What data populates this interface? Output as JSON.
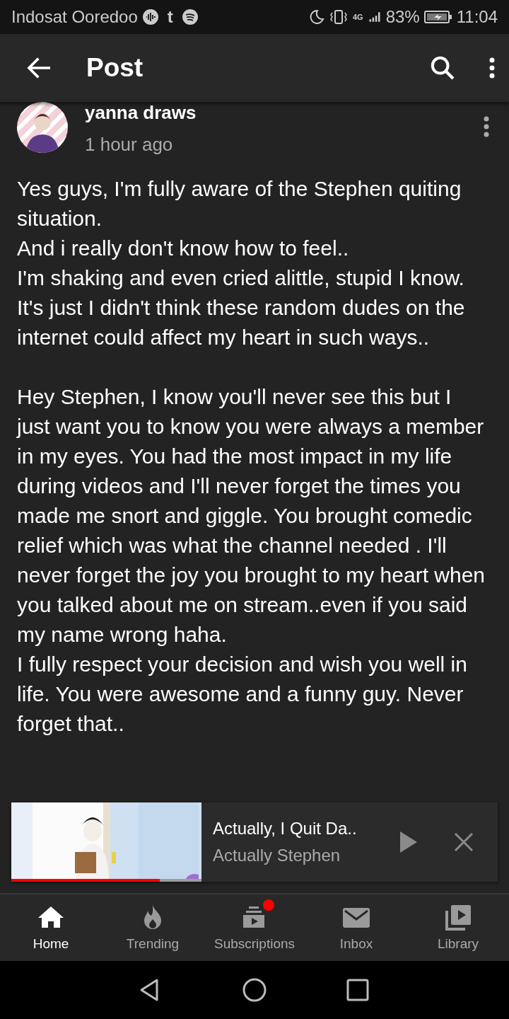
{
  "status_bar": {
    "carrier": "Indosat Ooredoo",
    "app_glyph": "t",
    "network": "4G",
    "battery": "83%",
    "time": "11:04"
  },
  "app_bar": {
    "title": "Post"
  },
  "post": {
    "author": "yanna draws",
    "time": "1 hour ago",
    "blocks": [
      [
        "Yes guys, I'm fully aware of the Stephen quiting situation.",
        "And i really don't know how to feel..",
        "I'm shaking and even cried alittle, stupid I know. It's just I didn't think these random dudes on the internet could affect my heart in such ways.."
      ],
      [
        "Hey Stephen, I know you'll never see this but I just want you to know you were always a member in my eyes. You had the most impact in my life during videos and I'll never forget the times you made me snort and giggle. You brought comedic relief which was what the channel needed . I'll never forget the joy you brought to my heart when you talked about me on stream..even if you said my name wrong haha.",
        "I fully respect your decision and wish you well in life. You were awesome and a funny guy. Never forget that.."
      ]
    ]
  },
  "mini_player": {
    "title": "Actually, I Quit Da..",
    "channel": "Actually Stephen",
    "level": 0.78
  },
  "nav": [
    {
      "kind": "home",
      "label": "Home",
      "selected": true,
      "badge": false
    },
    {
      "kind": "trending",
      "label": "Trending",
      "selected": false,
      "badge": false
    },
    {
      "kind": "subscriptions",
      "label": "Subscriptions",
      "selected": false,
      "badge": true
    },
    {
      "kind": "inbox",
      "label": "Inbox",
      "selected": false,
      "badge": false
    },
    {
      "kind": "library",
      "label": "Library",
      "selected": false,
      "badge": false
    }
  ]
}
